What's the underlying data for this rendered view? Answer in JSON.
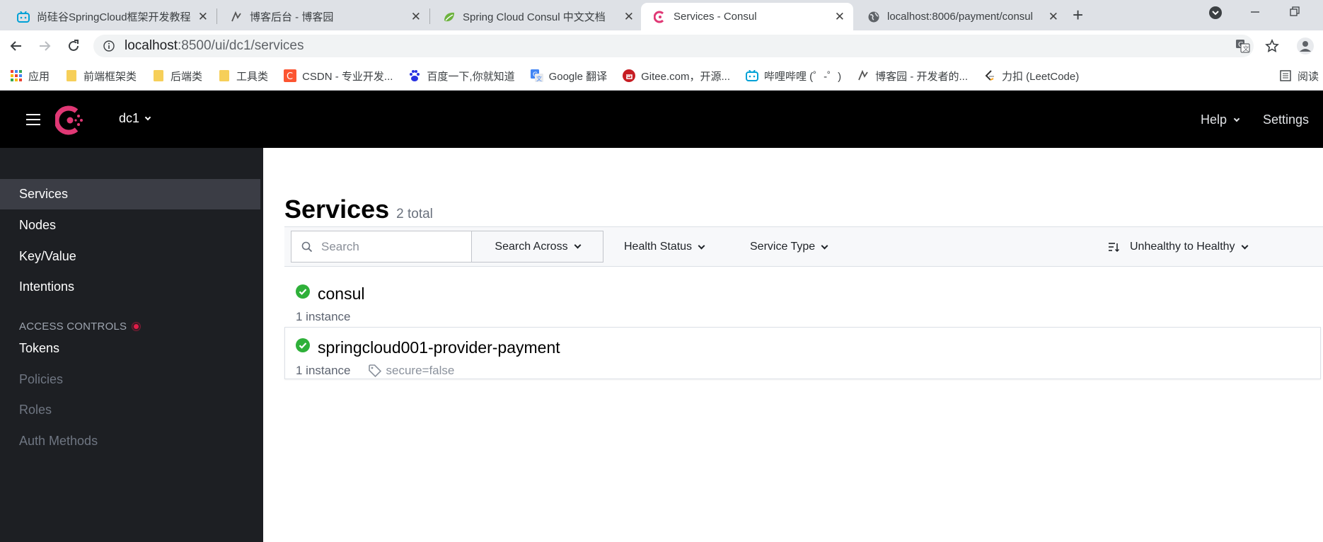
{
  "browser": {
    "tabs": [
      {
        "title": "尚硅谷SpringCloud框架开发教程",
        "favicon": "bilibili-icon"
      },
      {
        "title": "博客后台 - 博客园",
        "favicon": "cnblogs-icon"
      },
      {
        "title": "Spring Cloud Consul 中文文档",
        "favicon": "spring-icon"
      },
      {
        "title": "Services - Consul",
        "favicon": "consul-icon",
        "active": true
      },
      {
        "title": "localhost:8006/payment/consul",
        "favicon": "globe-icon"
      }
    ],
    "url_host": "localhost",
    "url_path": ":8500/ui/dc1/services",
    "bookmarks": [
      {
        "label": "应用",
        "icon": "apps-grid-icon"
      },
      {
        "label": "前端框架类",
        "icon": "folder-icon"
      },
      {
        "label": "后端类",
        "icon": "folder-icon"
      },
      {
        "label": "工具类",
        "icon": "folder-icon"
      },
      {
        "label": "CSDN - 专业开发...",
        "icon": "csdn-icon"
      },
      {
        "label": "百度一下,你就知道",
        "icon": "baidu-icon"
      },
      {
        "label": "Google 翻译",
        "icon": "google-translate-icon"
      },
      {
        "label": "Gitee.com，开源...",
        "icon": "gitee-icon"
      },
      {
        "label": "哔哩哔哩 (゜-゜)",
        "icon": "bilibili-icon"
      },
      {
        "label": "博客园 - 开发者的...",
        "icon": "cnblogs-icon"
      },
      {
        "label": "力扣 (LeetCode)",
        "icon": "leetcode-icon"
      }
    ],
    "reading_list": "阅读"
  },
  "header": {
    "datacenter": "dc1",
    "help_label": "Help",
    "settings_label": "Settings"
  },
  "sidebar": {
    "items": [
      {
        "label": "Services",
        "active": true
      },
      {
        "label": "Nodes"
      },
      {
        "label": "Key/Value"
      },
      {
        "label": "Intentions"
      }
    ],
    "access_heading": "ACCESS CONTROLS",
    "access_items": [
      {
        "label": "Tokens",
        "enabled": true
      },
      {
        "label": "Policies",
        "enabled": false
      },
      {
        "label": "Roles",
        "enabled": false
      },
      {
        "label": "Auth Methods",
        "enabled": false
      }
    ]
  },
  "main": {
    "title": "Services",
    "count": "2 total",
    "search_placeholder": "Search",
    "search_across": "Search Across",
    "health_status": "Health Status",
    "service_type": "Service Type",
    "sort": "Unhealthy to Healthy",
    "services": [
      {
        "name": "consul",
        "instances": "1 instance",
        "status": "passing"
      },
      {
        "name": "springcloud001-provider-payment",
        "instances": "1 instance",
        "tag": "secure=false",
        "status": "passing"
      }
    ]
  },
  "colors": {
    "brand": "#e03875",
    "passing": "#2eb039",
    "header_bg": "#000000",
    "sidebar_bg": "#1d1f23"
  }
}
